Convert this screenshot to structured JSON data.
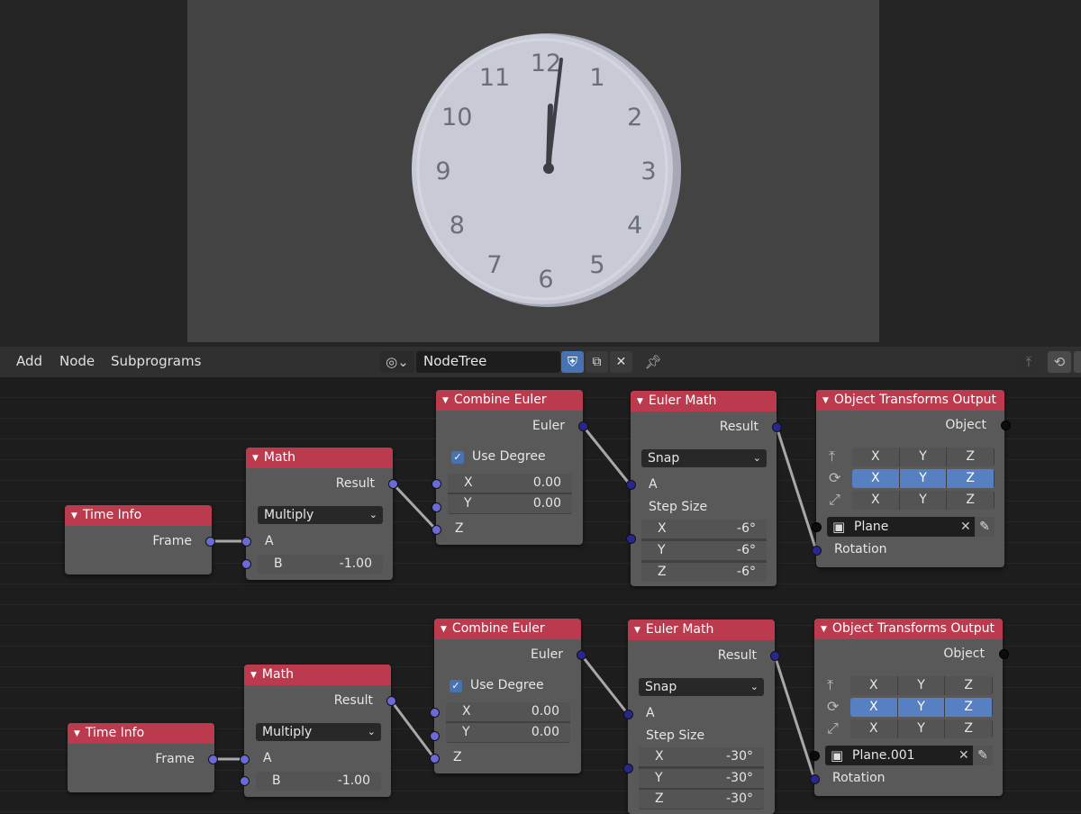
{
  "clock": {
    "numerals": [
      "12",
      "1",
      "2",
      "3",
      "4",
      "5",
      "6",
      "7",
      "8",
      "9",
      "10",
      "11"
    ]
  },
  "header": {
    "menus": [
      "Add",
      "Node",
      "Subprograms"
    ],
    "tree_name": "NodeTree",
    "icons": [
      "node-editor-icon",
      "shield-icon",
      "duplicate-icon",
      "close-icon",
      "pin-icon",
      "parent-icon",
      "lasso-icon"
    ]
  },
  "rows": [
    {
      "time_info": {
        "title": "Time Info",
        "frame": "Frame"
      },
      "math": {
        "title": "Math",
        "result": "Result",
        "operation": "Multiply",
        "a": "A",
        "b_label": "B",
        "b_value": "-1.00"
      },
      "combine": {
        "title": "Combine Euler",
        "euler": "Euler",
        "use_degree": "Use Degree",
        "x_label": "X",
        "x_value": "0.00",
        "y_label": "Y",
        "y_value": "0.00",
        "z_label": "Z"
      },
      "euler_math": {
        "title": "Euler Math",
        "result": "Result",
        "operation": "Snap",
        "a": "A",
        "step_size": "Step Size",
        "x_label": "X",
        "x_value": "-6°",
        "y_label": "Y",
        "y_value": "-6°",
        "z_label": "Z",
        "z_value": "-6°"
      },
      "output": {
        "title": "Object Transforms Output",
        "object": "Object",
        "x": "X",
        "y": "Y",
        "z": "Z",
        "object_name": "Plane",
        "rotation": "Rotation"
      }
    },
    {
      "time_info": {
        "title": "Time Info",
        "frame": "Frame"
      },
      "math": {
        "title": "Math",
        "result": "Result",
        "operation": "Multiply",
        "a": "A",
        "b_label": "B",
        "b_value": "-1.00"
      },
      "combine": {
        "title": "Combine Euler",
        "euler": "Euler",
        "use_degree": "Use Degree",
        "x_label": "X",
        "x_value": "0.00",
        "y_label": "Y",
        "y_value": "0.00",
        "z_label": "Z"
      },
      "euler_math": {
        "title": "Euler Math",
        "result": "Result",
        "operation": "Snap",
        "a": "A",
        "step_size": "Step Size",
        "x_label": "X",
        "x_value": "-30°",
        "y_label": "Y",
        "y_value": "-30°",
        "z_label": "Z",
        "z_value": "-30°"
      },
      "output": {
        "title": "Object Transforms Output",
        "object": "Object",
        "x": "X",
        "y": "Y",
        "z": "Z",
        "object_name": "Plane.001",
        "rotation": "Rotation"
      }
    }
  ]
}
